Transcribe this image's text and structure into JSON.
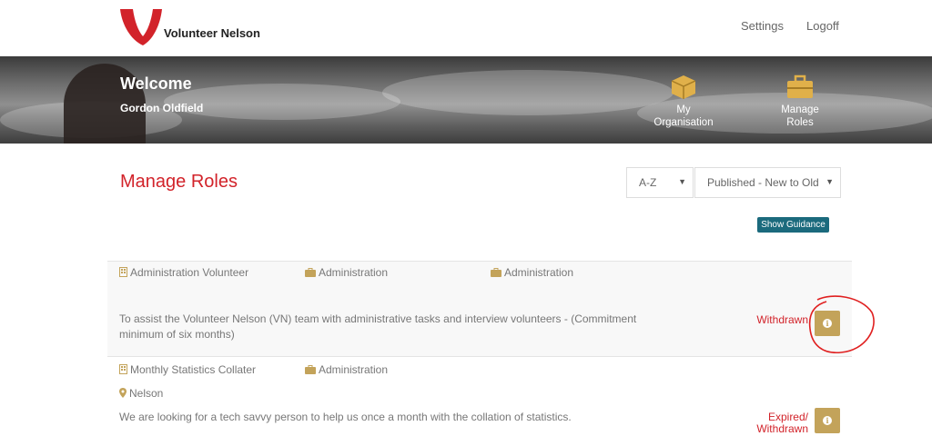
{
  "brand": {
    "name": "Volunteer Nelson",
    "accent": "#d2232a",
    "gold": "#c3a35a",
    "teal": "#1b6a7d"
  },
  "nav": {
    "settings": "Settings",
    "logoff": "Logoff"
  },
  "hero": {
    "title": "Welcome",
    "user": "Gordon Oldfield",
    "links": [
      {
        "label_line1": "My",
        "label_line2": "Organisation",
        "icon": "box-icon"
      },
      {
        "label_line1": "Manage",
        "label_line2": "Roles",
        "icon": "briefcase-icon"
      }
    ]
  },
  "main": {
    "title": "Manage Roles",
    "sort": {
      "alpha": "A-Z",
      "order": "Published - New to Old"
    },
    "guidance_button": "Show Guidance"
  },
  "roles": [
    {
      "title": "Administration Volunteer",
      "category": "Administration",
      "category2": "Administration",
      "description": "To assist the Volunteer Nelson (VN) team with administrative tasks and interview volunteers - (Commitment minimum of six months)",
      "status": "Withdrawn"
    },
    {
      "title": "Monthly Statistics Collater",
      "category": "Administration",
      "location": "Nelson",
      "description": "We are looking for a tech savvy person to help us once a month with the collation of statistics.",
      "status_line1": "Expired/",
      "status_line2": "Withdrawn"
    }
  ]
}
